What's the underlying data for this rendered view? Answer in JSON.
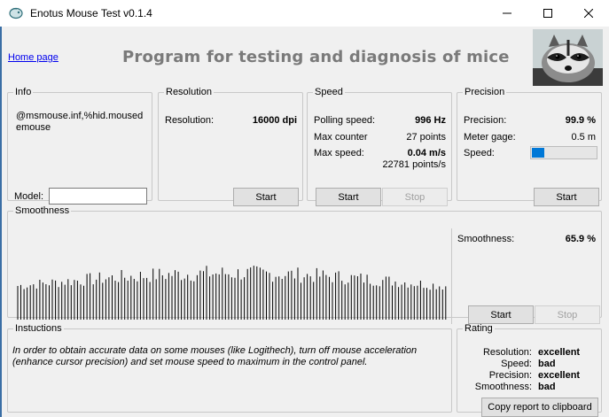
{
  "window": {
    "title": "Enotus Mouse Test v0.1.4"
  },
  "header": {
    "home_link": "Home page",
    "banner": "Program for testing and diagnosis of mice"
  },
  "info": {
    "legend": "Info",
    "device_text": "@msmouse.inf,%hid.mousedemouse",
    "model_label": "Model:",
    "model_value": ""
  },
  "resolution": {
    "legend": "Resolution",
    "label": "Resolution:",
    "value": "16000 dpi",
    "start": "Start"
  },
  "speed": {
    "legend": "Speed",
    "polling_label": "Polling speed:",
    "polling_value": "996 Hz",
    "counter_label": "Max counter",
    "counter_value": "27 points",
    "max_label": "Max  speed:",
    "max_value": "0.04 m/s",
    "max_points": "22781 points/s",
    "start": "Start",
    "stop": "Stop"
  },
  "precision": {
    "legend": "Precision",
    "label": "Precision:",
    "value": "99.9 %",
    "gage_label": "Meter gage:",
    "gage_value": "0.5 m",
    "speed_label": "Speed:",
    "speed_level": 0.2,
    "start": "Start"
  },
  "smoothness": {
    "legend": "Smoothness",
    "label": "Smoothness:",
    "value": "65.9 %",
    "start": "Start",
    "stop": "Stop"
  },
  "instructions": {
    "legend": "Instuctions",
    "text": "In order to obtain accurate data on some mouses (like Logithech), turn off mouse acceleration (enhance cursor precision) and set mouse speed to maximum in the control panel."
  },
  "rating": {
    "legend": "Rating",
    "rows": [
      {
        "key": "Resolution:",
        "value": "excellent"
      },
      {
        "key": "Speed:",
        "value": "bad"
      },
      {
        "key": "Precision:",
        "value": "excellent"
      },
      {
        "key": "Smoothness:",
        "value": "bad"
      }
    ],
    "copy_button": "Copy report to clipboard"
  },
  "colors": {
    "accent": "#0078d7",
    "banner_text": "#7a7a7a",
    "link": "#0000ee"
  }
}
